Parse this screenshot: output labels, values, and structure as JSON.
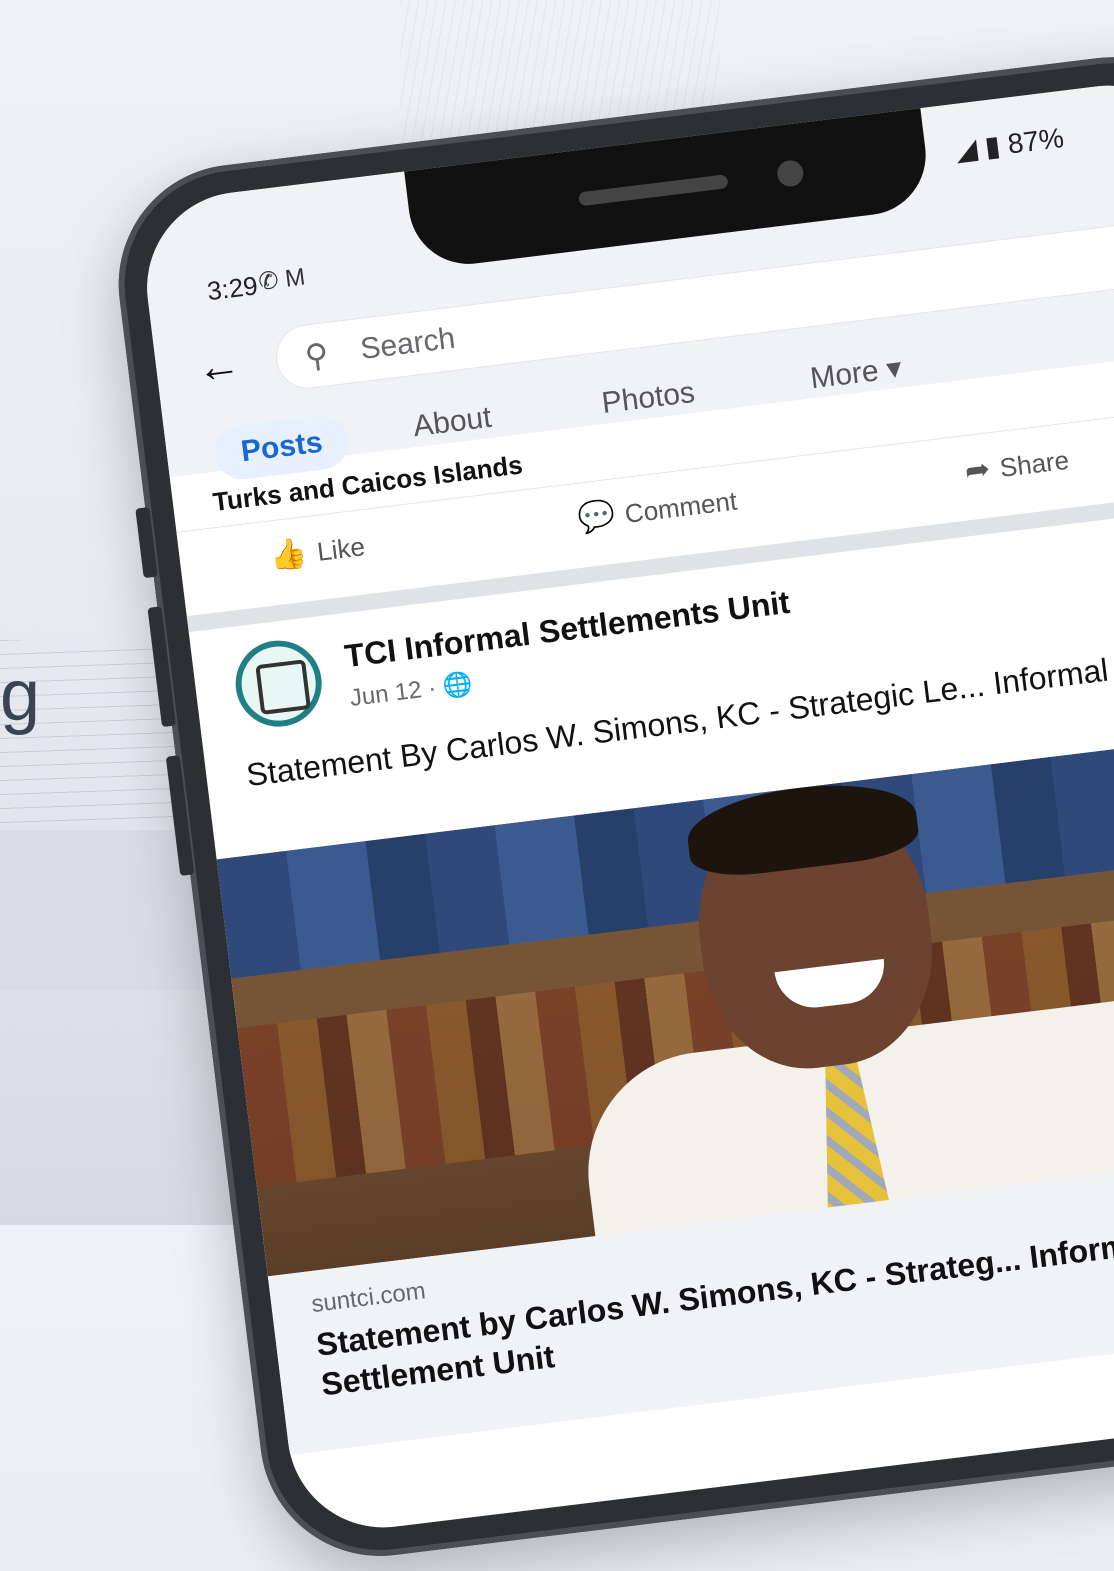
{
  "status": {
    "time": "3:29",
    "left_icons": "✆ M",
    "battery": "87%"
  },
  "search": {
    "placeholder": "Search"
  },
  "tabs": [
    {
      "label": "Posts"
    },
    {
      "label": "About"
    },
    {
      "label": "Photos"
    },
    {
      "label": "More ▾"
    }
  ],
  "previous_post": {
    "location": "Turks and Caicos Islands"
  },
  "actions": {
    "like": "Like",
    "comment": "Comment",
    "share": "Share"
  },
  "post": {
    "page_name": "TCI Informal Settlements Unit",
    "date": "Jun 12 · 🌐",
    "text": "Statement By Carlos W. Simons, KC - Strategic Le... Informal Settlement Unit."
  },
  "link_preview": {
    "domain": "suntci.com",
    "title": "Statement by Carlos W. Simons, KC - Strateg... Informal Settlement Unit"
  },
  "background": {
    "side_letter": "g"
  }
}
